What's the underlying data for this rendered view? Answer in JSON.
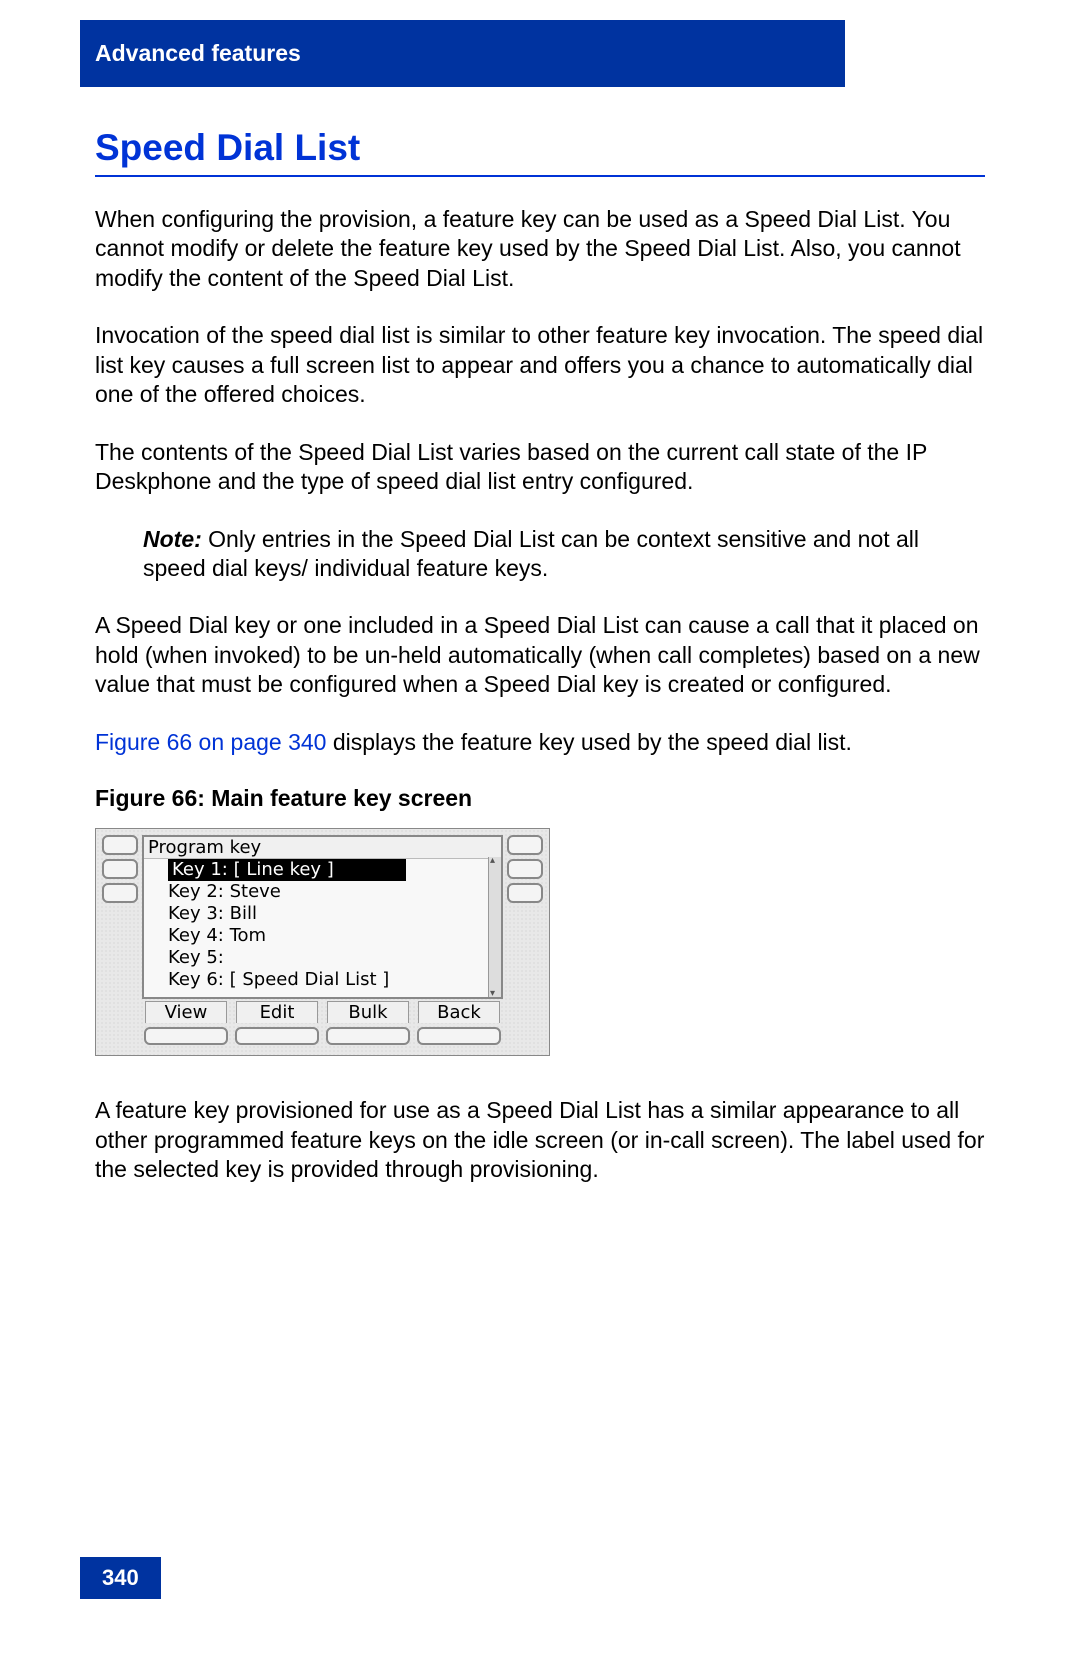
{
  "header": {
    "chapter": "Advanced features"
  },
  "title": "Speed Dial List",
  "paragraphs": {
    "p1": "When configuring the provision, a feature key can be used as a Speed Dial List. You cannot modify or delete the feature key used by the Speed Dial List. Also, you cannot modify the content of the Speed Dial List.",
    "p2": "Invocation of the speed dial list is similar to other feature key invocation. The speed dial list key causes a full screen list to appear and offers you a chance to automatically dial one of the offered choices.",
    "p3": "The contents of the Speed Dial List varies based on the current call state of the IP Deskphone and the type of speed dial list entry configured.",
    "note_label": "Note:",
    "note_body": "  Only entries in the Speed Dial List can be context sensitive and not all speed dial keys/ individual feature keys.",
    "p4": "A Speed Dial key or one included in a Speed Dial List can cause a call that it placed on hold (when invoked) to be un-held automatically (when call completes) based on a new value that must be configured when a Speed Dial key is created or configured.",
    "figref": "Figure 66 on page 340",
    "p5_tail": " displays the feature key used by the speed dial list.",
    "p6": "A feature key provisioned for use as a Speed Dial List has a similar appearance to all other programmed feature keys on the idle screen (or in-call screen). The label used for the selected key is provided through provisioning."
  },
  "figure": {
    "caption": "Figure 66: Main feature key screen",
    "lcd_title": "Program key",
    "items": [
      "Key 1: [ Line key ]",
      "Key 2: Steve",
      "Key 3: Bill",
      "Key 4: Tom",
      "Key 5:",
      "Key 6: [ Speed Dial List ]"
    ],
    "selected_index": 0,
    "softkeys": [
      "View",
      "Edit",
      "Bulk",
      "Back"
    ]
  },
  "footer": {
    "page_number": "340"
  }
}
